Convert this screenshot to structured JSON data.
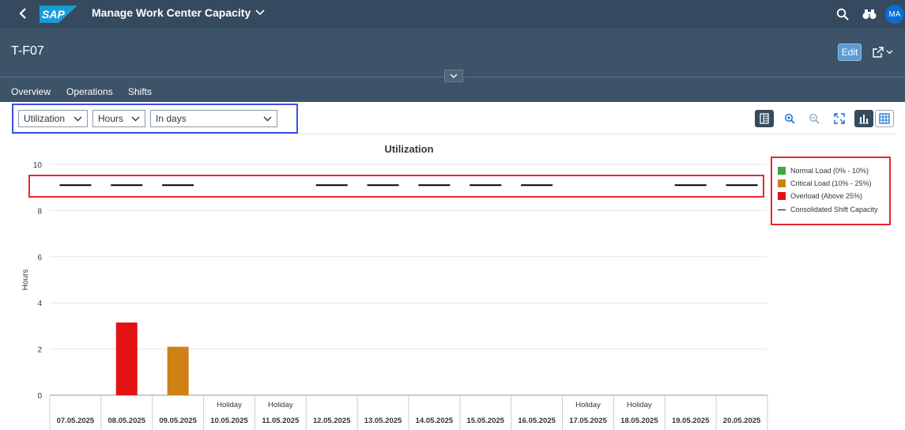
{
  "shell": {
    "app_title": "Manage Work Center Capacity",
    "logo_text": "SAP",
    "avatar_initials": "MA",
    "icons": [
      "back-icon",
      "search-icon",
      "binoculars-icon"
    ]
  },
  "header": {
    "object_title": "T-F07",
    "edit_label": "Edit",
    "tabs": [
      {
        "label": "Overview",
        "active": true
      },
      {
        "label": "Operations",
        "active": false
      },
      {
        "label": "Shifts",
        "active": false
      }
    ]
  },
  "toolbar": {
    "measure_select": "Utilization",
    "unit_select": "Hours",
    "period_select": "In days",
    "buttons": [
      "table-view-icon",
      "zoom-in-icon",
      "zoom-out-icon",
      "fullscreen-icon",
      "chart-view-icon",
      "grid-view-icon"
    ]
  },
  "legend": {
    "items": [
      {
        "label": "Normal Load (0% - 10%)",
        "color": "#3fa64a",
        "kind": "swatch"
      },
      {
        "label": "Critical Load (10% - 25%)",
        "color": "#d08014",
        "kind": "swatch"
      },
      {
        "label": "Overload (Above 25%)",
        "color": "#e31212",
        "kind": "swatch"
      },
      {
        "label": "Consolidated Shift Capacity",
        "color": "#000000",
        "kind": "line"
      }
    ]
  },
  "chart_data": {
    "type": "bar",
    "title": "Utilization",
    "ylabel": "Hours",
    "xlabel": "",
    "ylim": [
      0,
      10
    ],
    "yticks": [
      0,
      2,
      4,
      6,
      8,
      10
    ],
    "grid": true,
    "legend_position": "right",
    "categories": [
      "07.05.2025",
      "08.05.2025",
      "09.05.2025",
      "10.05.2025",
      "11.05.2025",
      "12.05.2025",
      "13.05.2025",
      "14.05.2025",
      "15.05.2025",
      "16.05.2025",
      "17.05.2025",
      "18.05.2025",
      "19.05.2025",
      "20.05.2025"
    ],
    "category_notes": [
      "",
      "",
      "",
      "Holiday",
      "Holiday",
      "",
      "",
      "",
      "",
      "",
      "Holiday",
      "Holiday",
      "",
      ""
    ],
    "series": [
      {
        "name": "Overload (Above 25%)",
        "color": "#e31212",
        "values": [
          0,
          3.15,
          0,
          0,
          0,
          0,
          0,
          0,
          0,
          0,
          0,
          0,
          0,
          0
        ]
      },
      {
        "name": "Critical Load (10% - 25%)",
        "color": "#d08014",
        "values": [
          0,
          0,
          2.1,
          0,
          0,
          0,
          0,
          0,
          0,
          0,
          0,
          0,
          0,
          0
        ]
      },
      {
        "name": "Consolidated Shift Capacity",
        "color": "#000000",
        "values": [
          9.1,
          9.1,
          9.1,
          null,
          null,
          9.1,
          9.1,
          9.1,
          9.1,
          9.1,
          null,
          null,
          9.1,
          9.1
        ]
      }
    ]
  }
}
